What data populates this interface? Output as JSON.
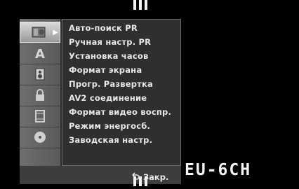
{
  "sidebar": {
    "items": [
      {
        "icon": "disc-setup-icon",
        "active": true
      },
      {
        "icon": "language-a-icon",
        "active": false
      },
      {
        "icon": "speaker-audio-icon",
        "active": false
      },
      {
        "icon": "padlock-icon",
        "active": false
      },
      {
        "icon": "film-record-icon",
        "active": false
      },
      {
        "icon": "disc-icon",
        "active": false
      }
    ]
  },
  "menu": {
    "items": [
      {
        "label": "Авто-поиск PR"
      },
      {
        "label": "Ручная настр. PR"
      },
      {
        "label": "Установка часов"
      },
      {
        "label": "Формат экрана"
      },
      {
        "label": "Прогр. Развертка"
      },
      {
        "label": "AV2 соединение"
      },
      {
        "label": "Формат видео воспр."
      },
      {
        "label": "Режим энергосб."
      },
      {
        "label": "Заводская настр."
      }
    ]
  },
  "footer": {
    "close_label": "Закр.",
    "close_icon": "return-arrow-icon"
  },
  "model_text": "EU-6CH"
}
